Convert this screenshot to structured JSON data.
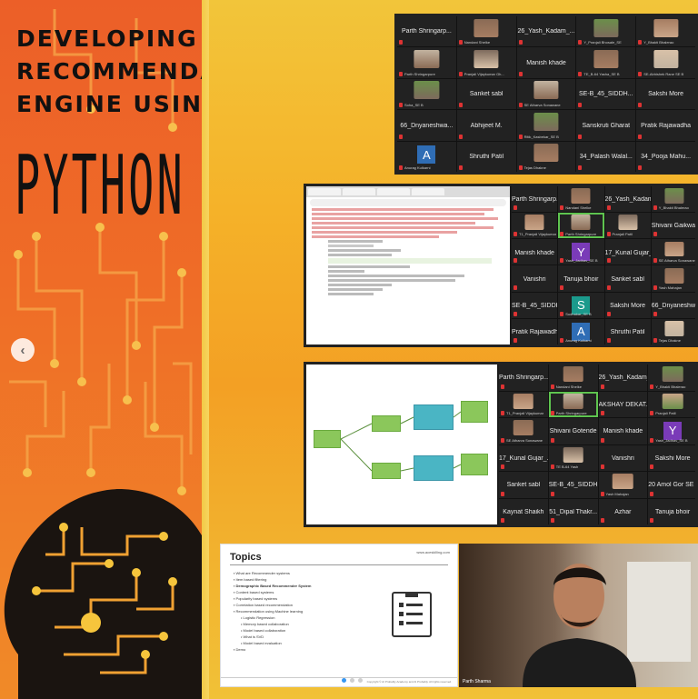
{
  "poster": {
    "headline_lines": [
      "DEVELOPING",
      "RECOMMENDATION",
      "ENGINE USING"
    ],
    "big_word": "PYTHON",
    "accent": "#f08a28"
  },
  "gallery1": {
    "tiles": [
      {
        "name": "Parth Shringarp...",
        "type": "name"
      },
      {
        "name": "",
        "type": "photo",
        "label": "Nandani Shelke"
      },
      {
        "name": "26_Yash_Kadam_...",
        "type": "name"
      },
      {
        "name": "",
        "type": "photo",
        "label": "Y_Pranjali Bhosale_SE"
      },
      {
        "name": "",
        "type": "photo",
        "label": "Y_Bhakti Bhalerao"
      },
      {
        "name": "",
        "type": "photo",
        "label": "Parth Shringarpure"
      },
      {
        "name": "",
        "type": "photo",
        "label": "Pranjali Vijaykumar Gh..."
      },
      {
        "name": "Manish khade",
        "type": "name"
      },
      {
        "name": "",
        "type": "photo",
        "label": "TE_B-64 Yasha_SE B"
      },
      {
        "name": "",
        "type": "photo",
        "label": "SE-Abhishek Rane SE B"
      },
      {
        "name": "",
        "type": "photo",
        "label": "Soha_SE B"
      },
      {
        "name": "Sanket sabl",
        "type": "name"
      },
      {
        "name": "",
        "type": "photo",
        "label": "SE Atharva Sonawane"
      },
      {
        "name": "SE-B_45_SIDDH...",
        "type": "name"
      },
      {
        "name": "Sakshi More",
        "type": "name"
      },
      {
        "name": "66_Dnyaneshwa...",
        "type": "name"
      },
      {
        "name": "Abhijeet M.",
        "type": "name"
      },
      {
        "name": "",
        "type": "photo",
        "label": "Ritik_Kasbekar_SE B"
      },
      {
        "name": "Sanskruti Gharat",
        "type": "name"
      },
      {
        "name": "Pratik Rajawadha",
        "type": "name"
      },
      {
        "name": "",
        "type": "letter",
        "letter": "A",
        "color": "#2f6db5",
        "label": "Anurag Kulkarni"
      },
      {
        "name": "Shruthi Patil",
        "type": "name"
      },
      {
        "name": "",
        "type": "photo",
        "label": "Tejas Dhakne"
      },
      {
        "name": "34_Palash Walal...",
        "type": "name"
      },
      {
        "name": "34_Pooja Mahu...",
        "type": "name"
      }
    ]
  },
  "gallery2": {
    "tiles": [
      {
        "name": "Parth Shringarp...",
        "type": "name"
      },
      {
        "name": "",
        "type": "photo",
        "label": "Nandani Shelke"
      },
      {
        "name": "26_Yash_Kadam_...",
        "type": "name"
      },
      {
        "name": "",
        "type": "photo",
        "label": "Y_Bhakti Bhalerao"
      },
      {
        "name": "",
        "type": "photo",
        "label": "T1_Pranjali Vijaykumar"
      },
      {
        "name": "",
        "type": "photo",
        "label": "Parth Shringarpure",
        "active": true
      },
      {
        "name": "",
        "type": "photo",
        "label": "Pranjali Patil"
      },
      {
        "name": "Shivani Gaikwade",
        "type": "name"
      },
      {
        "name": "Manish khade",
        "type": "name"
      },
      {
        "name": "",
        "type": "letter",
        "letter": "Y",
        "color": "#7a3bb8",
        "label": "Yash_Jadhav_SE B"
      },
      {
        "name": "17_Kunal Gujar_...",
        "type": "name"
      },
      {
        "name": "",
        "type": "photo",
        "label": "SE Atharva Sonawane"
      },
      {
        "name": "Vanishri",
        "type": "name"
      },
      {
        "name": "Tanuja bhoir",
        "type": "name"
      },
      {
        "name": "Sanket sabl",
        "type": "name"
      },
      {
        "name": "",
        "type": "photo",
        "label": "Yash Mahajan"
      },
      {
        "name": "SE-B_45_SIDDH...",
        "type": "name"
      },
      {
        "name": "",
        "type": "letter",
        "letter": "S",
        "color": "#1b9a8c",
        "label": "Sudhakar_SE B"
      },
      {
        "name": "Sakshi More",
        "type": "name"
      },
      {
        "name": "66_Dnyaneshwa...",
        "type": "name"
      },
      {
        "name": "Pratik Rajawadha",
        "type": "name"
      },
      {
        "name": "",
        "type": "letter",
        "letter": "A",
        "color": "#2f6db5",
        "label": "Anurag Kulkarni"
      },
      {
        "name": "Shruthi Patil",
        "type": "name"
      },
      {
        "name": "",
        "type": "photo",
        "label": "Tejas Dhakne"
      }
    ]
  },
  "gallery3": {
    "tiles": [
      {
        "name": "Parth Shringarp...",
        "type": "name"
      },
      {
        "name": "",
        "type": "photo",
        "label": "Nandani Shelke"
      },
      {
        "name": "26_Yash_Kadam_...",
        "type": "name"
      },
      {
        "name": "",
        "type": "photo",
        "label": "Y_Bhakti Bhalerao"
      },
      {
        "name": "",
        "type": "photo",
        "label": "T1_Pranjali Vijaykumar"
      },
      {
        "name": "",
        "type": "photo",
        "label": "Parth Shringarpure",
        "active": true
      },
      {
        "name": "AKSHAY DEKAT...",
        "type": "name"
      },
      {
        "name": "",
        "type": "photo",
        "label": "Pranjali Patil"
      },
      {
        "name": "",
        "type": "photo",
        "label": "SE Atharva Sonawane"
      },
      {
        "name": "Shivani Gotende",
        "type": "name"
      },
      {
        "name": "Manish khade",
        "type": "name"
      },
      {
        "name": "",
        "type": "letter",
        "letter": "Y",
        "color": "#7a3bb8",
        "label": "Yash_Jadhav_SE B"
      },
      {
        "name": "17_Kunal Gujar_...",
        "type": "name"
      },
      {
        "name": "",
        "type": "photo",
        "label": "TE B-64 Yash"
      },
      {
        "name": "Vanishri",
        "type": "name"
      },
      {
        "name": "Sakshi More",
        "type": "name"
      },
      {
        "name": "Sanket sabl",
        "type": "name"
      },
      {
        "name": "SE-B_45_SIDDH...",
        "type": "name"
      },
      {
        "name": "",
        "type": "photo",
        "label": "Yash Mahajan"
      },
      {
        "name": "20 Amol Gor SE B",
        "type": "name"
      },
      {
        "name": "Kaynat Shaikh",
        "type": "name"
      },
      {
        "name": "51_Dipal Thakr...",
        "type": "name"
      },
      {
        "name": "Azhar",
        "type": "name"
      },
      {
        "name": "Tanuja bhoir",
        "type": "name"
      }
    ]
  },
  "slide_topics": {
    "title": "Topics",
    "site": "www.aceskilling.com",
    "items": [
      {
        "text": "What are Recommender systems",
        "level": 0
      },
      {
        "text": "Item based filtering",
        "level": 0
      },
      {
        "text": "Demographic Based Recommender System",
        "level": 0,
        "bold": true
      },
      {
        "text": "Content based systems",
        "level": 0
      },
      {
        "text": "Popularity based systems",
        "level": 0
      },
      {
        "text": "Correlation based recommendation",
        "level": 0
      },
      {
        "text": "Recommendation using Machine learning",
        "level": 0
      },
      {
        "text": "Logistic Regression",
        "level": 1
      },
      {
        "text": "Memory based collaboration",
        "level": 1
      },
      {
        "text": "Model based collaboration",
        "level": 1
      },
      {
        "text": "What is SVD",
        "level": 1
      },
      {
        "text": "Model based evaluation",
        "level": 1
      },
      {
        "text": "Demo",
        "level": 0
      }
    ],
    "footer": "Copyright © AI Probably Academy and AI Probably. All rights reserved."
  },
  "presenter": {
    "name": "Parth Sharma"
  },
  "carousel": {
    "pages": 3,
    "current": 1
  }
}
